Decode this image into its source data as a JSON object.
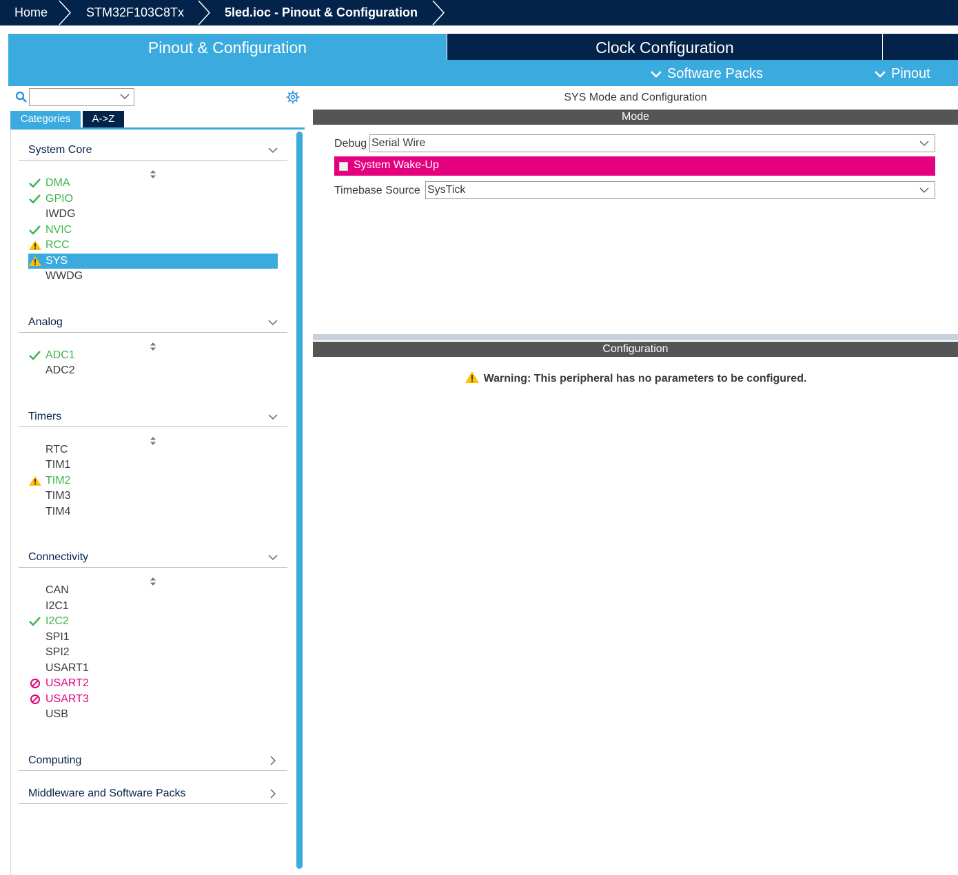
{
  "breadcrumb": [
    {
      "label": "Home"
    },
    {
      "label": "STM32F103C8Tx"
    },
    {
      "label": "5led.ioc - Pinout & Configuration"
    }
  ],
  "tabs": {
    "pinout": "Pinout & Configuration",
    "clock": "Clock Configuration"
  },
  "menus": {
    "software_packs": "Software Packs",
    "pinout": "Pinout"
  },
  "sidebar": {
    "search_value": "",
    "view_tabs": {
      "categories": "Categories",
      "az": "A->Z"
    },
    "categories": [
      {
        "title": "System Core",
        "expanded": true,
        "items": [
          {
            "label": "DMA",
            "status": "ok"
          },
          {
            "label": "GPIO",
            "status": "ok"
          },
          {
            "label": "IWDG",
            "status": "none"
          },
          {
            "label": "NVIC",
            "status": "ok"
          },
          {
            "label": "RCC",
            "status": "warning"
          },
          {
            "label": "SYS",
            "status": "warning",
            "selected": true
          },
          {
            "label": "WWDG",
            "status": "none"
          }
        ]
      },
      {
        "title": "Analog",
        "expanded": true,
        "items": [
          {
            "label": "ADC1",
            "status": "ok"
          },
          {
            "label": "ADC2",
            "status": "none"
          }
        ]
      },
      {
        "title": "Timers",
        "expanded": true,
        "items": [
          {
            "label": "RTC",
            "status": "none"
          },
          {
            "label": "TIM1",
            "status": "none"
          },
          {
            "label": "TIM2",
            "status": "warning"
          },
          {
            "label": "TIM3",
            "status": "none"
          },
          {
            "label": "TIM4",
            "status": "none"
          }
        ]
      },
      {
        "title": "Connectivity",
        "expanded": true,
        "items": [
          {
            "label": "CAN",
            "status": "none"
          },
          {
            "label": "I2C1",
            "status": "none"
          },
          {
            "label": "I2C2",
            "status": "ok"
          },
          {
            "label": "SPI1",
            "status": "none"
          },
          {
            "label": "SPI2",
            "status": "none"
          },
          {
            "label": "USART1",
            "status": "none"
          },
          {
            "label": "USART2",
            "status": "blocked"
          },
          {
            "label": "USART3",
            "status": "blocked"
          },
          {
            "label": "USB",
            "status": "none"
          }
        ]
      },
      {
        "title": "Computing",
        "expanded": false,
        "items": []
      },
      {
        "title": "Middleware and Software Packs",
        "expanded": false,
        "items": []
      }
    ]
  },
  "main": {
    "title": "SYS Mode and Configuration",
    "mode_header": "Mode",
    "debug_label": "Debug",
    "debug_value": "Serial Wire",
    "wakeup_label": "System Wake-Up",
    "wakeup_checked": false,
    "timebase_label": "Timebase Source",
    "timebase_value": "SysTick",
    "config_header": "Configuration",
    "warning_text": "Warning: This peripheral has no parameters to be configured."
  },
  "colors": {
    "navy": "#03234b",
    "accent_blue": "#3babdf",
    "ok_green": "#3cb44a",
    "warning_yellow": "#ffc000",
    "blocked_pink": "#e5007e",
    "section_gray": "#555555"
  }
}
